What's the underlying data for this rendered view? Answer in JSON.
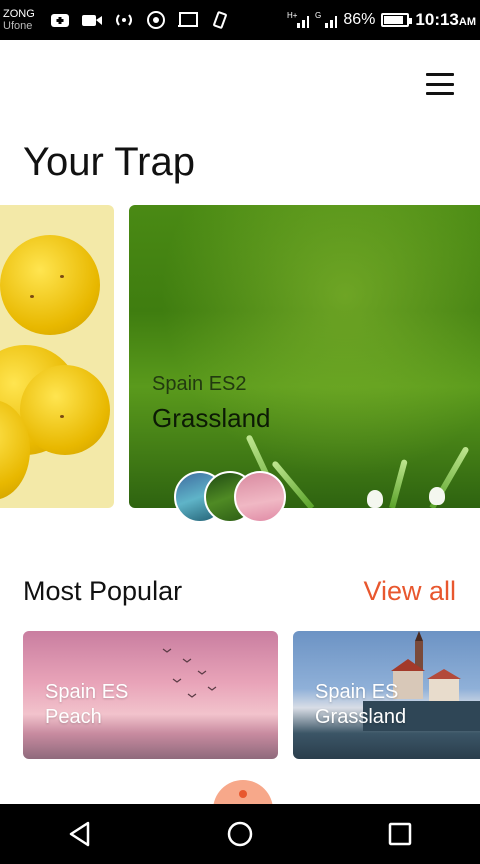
{
  "status_bar": {
    "carrier_1": "ZONG",
    "carrier_2": "Ufone",
    "network_1": "H+",
    "network_2": "G",
    "battery": "86%",
    "battery_level": 0.86,
    "time": "10:13",
    "time_suffix": "AM"
  },
  "header": {
    "title": "Your Trap",
    "menu_icon": "hamburger-menu-icon"
  },
  "featured": {
    "cards": [
      {
        "image": "lemons"
      },
      {
        "image": "grassland",
        "subtitle": "Spain ES2",
        "title": "Grassland"
      }
    ],
    "avatars": [
      "lake",
      "forest",
      "pink-sky"
    ]
  },
  "popular": {
    "title": "Most Popular",
    "view_all": "View all",
    "cards": [
      {
        "line1": "Spain ES",
        "line2": "Peach"
      },
      {
        "line1": "Spain ES",
        "line2": "Grassland"
      }
    ]
  },
  "nav": {
    "back": "back-icon",
    "home": "home-icon",
    "recents": "recents-icon"
  },
  "colors": {
    "accent": "#e8572e",
    "text": "#111111"
  }
}
